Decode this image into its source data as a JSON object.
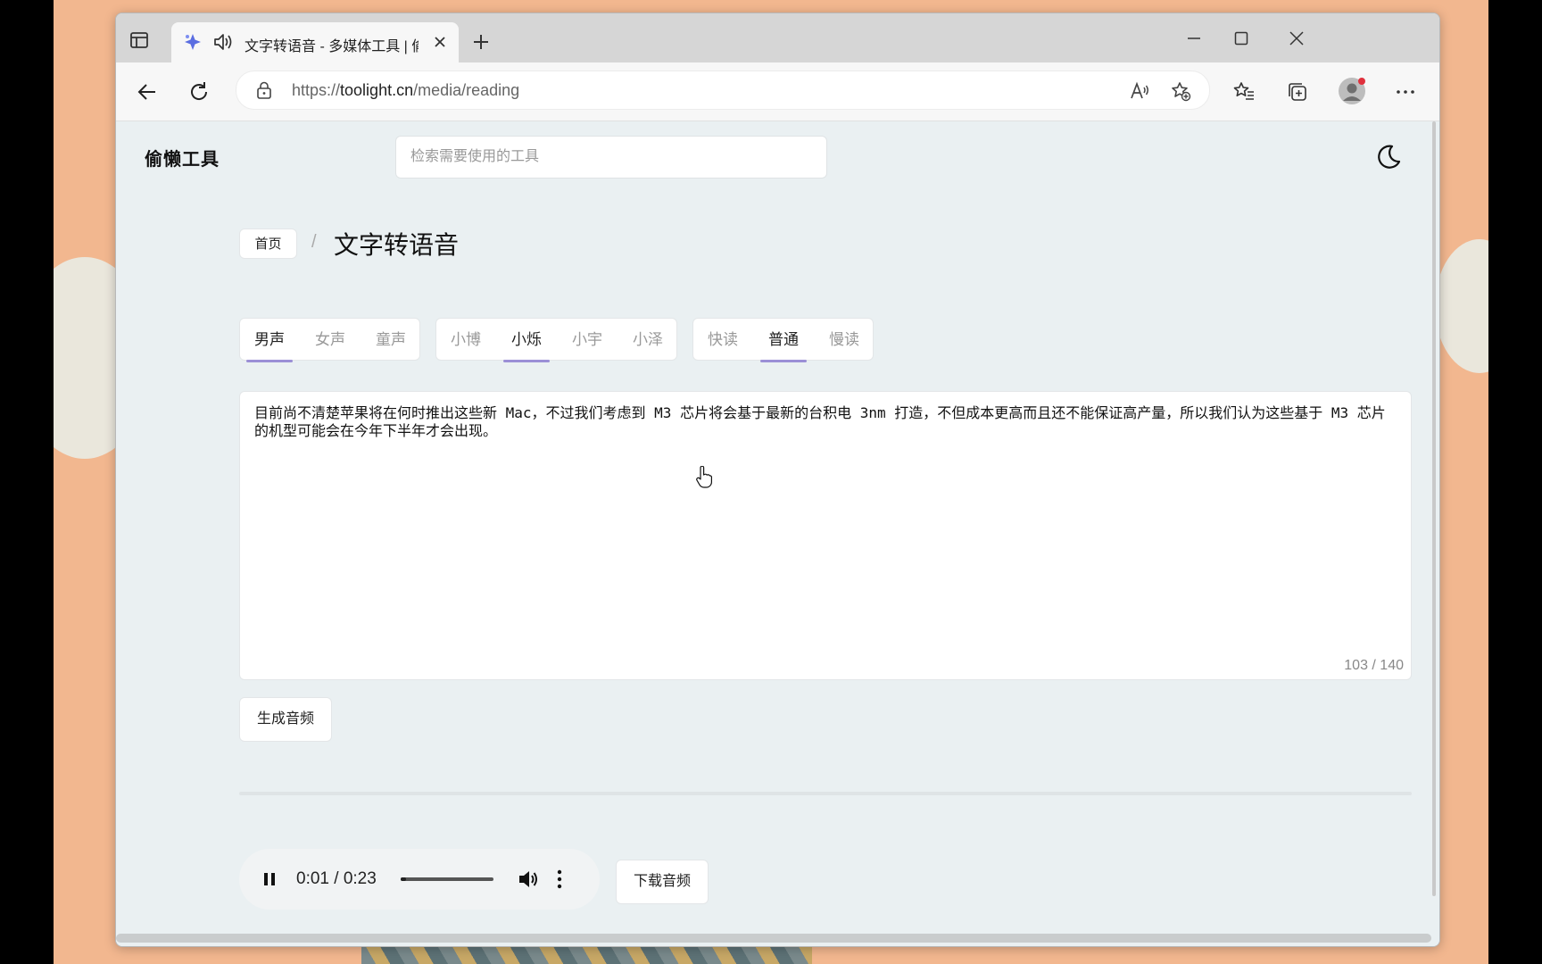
{
  "browser": {
    "tab_title": "文字转语音 - 多媒体工具 | 偷",
    "url_prefix": "https://",
    "url_domain": "toolight.cn",
    "url_path": "/media/reading"
  },
  "site": {
    "logo": "偷懒工具",
    "search_placeholder": "检索需要使用的工具"
  },
  "breadcrumb": {
    "home": "首页",
    "separator": "/",
    "current": "文字转语音"
  },
  "options": {
    "gender": [
      {
        "label": "男声",
        "selected": true
      },
      {
        "label": "女声",
        "selected": false
      },
      {
        "label": "童声",
        "selected": false
      }
    ],
    "voice": [
      {
        "label": "小博",
        "selected": false
      },
      {
        "label": "小烁",
        "selected": true
      },
      {
        "label": "小宇",
        "selected": false
      },
      {
        "label": "小泽",
        "selected": false
      }
    ],
    "speed": [
      {
        "label": "快读",
        "selected": false
      },
      {
        "label": "普通",
        "selected": true
      },
      {
        "label": "慢读",
        "selected": false
      }
    ]
  },
  "editor": {
    "text": "目前尚不清楚苹果将在何时推出这些新 Mac，不过我们考虑到 M3 芯片将会基于最新的台积电 3nm 打造，不但成本更高而且还不能保证高产量，所以我们认为这些基于 M3 芯片的机型可能会在今年下半年才会出现。",
    "char_count": "103 / 140"
  },
  "actions": {
    "generate": "生成音频",
    "download": "下载音频"
  },
  "player": {
    "time": "0:01 / 0:23",
    "progress": 0.06
  },
  "colors": {
    "accent_underline": "#9b8fd6",
    "page_bg": "#eaf0f2",
    "desktop_bg": "#f2b78f"
  }
}
